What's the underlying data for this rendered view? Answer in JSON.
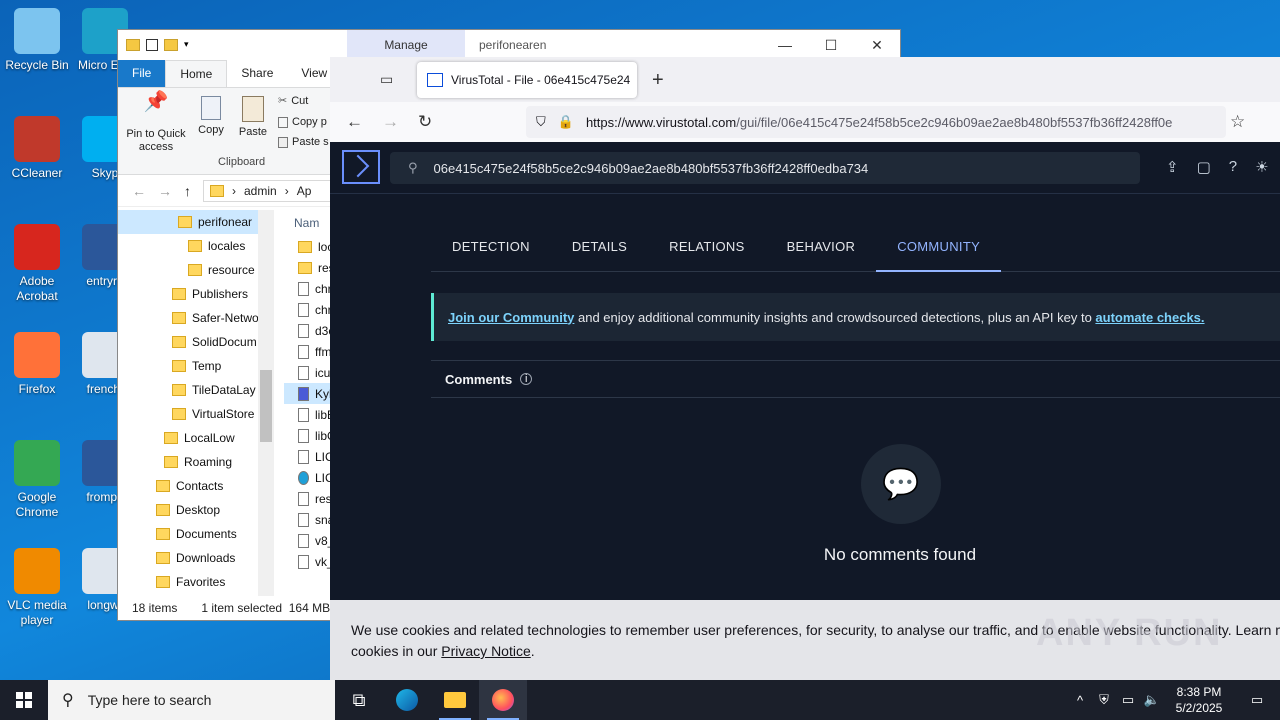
{
  "desktop": {
    "icons_left": [
      {
        "label": "Recycle Bin",
        "icon": "recycle-bin-icon",
        "color": "#7cc4ef"
      },
      {
        "label": "CCleaner",
        "icon": "ccleaner-icon",
        "color": "#c0392b"
      },
      {
        "label": "Adobe Acrobat",
        "icon": "adobe-acrobat-icon",
        "color": "#d7261e"
      },
      {
        "label": "Firefox",
        "icon": "firefox-icon",
        "color": "#ff7139"
      },
      {
        "label": "Google Chrome",
        "icon": "chrome-icon",
        "color": "#34a853"
      },
      {
        "label": "VLC media player",
        "icon": "vlc-icon",
        "color": "#f08a00"
      }
    ],
    "icons_right": [
      {
        "label": "Micro Edg",
        "icon": "edge-icon",
        "color": "#1da1c9"
      },
      {
        "label": "Skyp",
        "icon": "skype-icon",
        "color": "#00aff0"
      },
      {
        "label": "entryre",
        "icon": "word-doc-icon",
        "color": "#2b579a"
      },
      {
        "label": "frencht",
        "icon": "image-file-icon",
        "color": "#dfe6ee"
      },
      {
        "label": "frompa",
        "icon": "word-doc-icon",
        "color": "#2b579a"
      },
      {
        "label": "longwr",
        "icon": "image-file-icon",
        "color": "#dfe6ee"
      }
    ]
  },
  "explorer": {
    "manage_tab": "Manage",
    "title": "perifonearen",
    "window_controls": {
      "minimize": "—",
      "maximize": "☐",
      "close": "✕"
    },
    "ribbon_tabs": [
      "File",
      "Home",
      "Share",
      "View"
    ],
    "ribbon": {
      "pin_label": "Pin to Quick access",
      "copy_label": "Copy",
      "paste_label": "Paste",
      "cut_label": "Cut",
      "copy_path_label": "Copy p",
      "paste_shortcut_label": "Paste s",
      "group_label": "Clipboard"
    },
    "address": {
      "crumbs": [
        "admin",
        "Ap"
      ]
    },
    "nav_items": [
      {
        "label": "perifonear",
        "indent": 60,
        "selected": true
      },
      {
        "label": "locales",
        "indent": 70,
        "selected": false
      },
      {
        "label": "resource",
        "indent": 70,
        "selected": false
      },
      {
        "label": "Publishers",
        "indent": 54,
        "selected": false
      },
      {
        "label": "Safer-Netwo",
        "indent": 54,
        "selected": false
      },
      {
        "label": "SolidDocum",
        "indent": 54,
        "selected": false
      },
      {
        "label": "Temp",
        "indent": 54,
        "selected": false
      },
      {
        "label": "TileDataLay",
        "indent": 54,
        "selected": false
      },
      {
        "label": "VirtualStore",
        "indent": 54,
        "selected": false
      },
      {
        "label": "LocalLow",
        "indent": 46,
        "selected": false
      },
      {
        "label": "Roaming",
        "indent": 46,
        "selected": false
      },
      {
        "label": "Contacts",
        "indent": 38,
        "selected": false
      },
      {
        "label": "Desktop",
        "indent": 38,
        "selected": false
      },
      {
        "label": "Documents",
        "indent": 38,
        "selected": false
      },
      {
        "label": "Downloads",
        "indent": 38,
        "selected": false
      },
      {
        "label": "Favorites",
        "indent": 38,
        "selected": false
      }
    ],
    "column_header": "Nam",
    "files": [
      {
        "name": "loc",
        "type": "folder"
      },
      {
        "name": "res",
        "type": "folder"
      },
      {
        "name": "chr",
        "type": "doc"
      },
      {
        "name": "chr",
        "type": "doc"
      },
      {
        "name": "d3c",
        "type": "doc"
      },
      {
        "name": "ffm",
        "type": "doc"
      },
      {
        "name": "icu",
        "type": "doc"
      },
      {
        "name": "Kyl",
        "type": "exe",
        "selected": true
      },
      {
        "name": "libE",
        "type": "doc"
      },
      {
        "name": "libG",
        "type": "doc"
      },
      {
        "name": "LIC",
        "type": "doc"
      },
      {
        "name": "LIC",
        "type": "edge"
      },
      {
        "name": "res",
        "type": "doc"
      },
      {
        "name": "sna",
        "type": "doc"
      },
      {
        "name": "v8_",
        "type": "doc"
      },
      {
        "name": "vk_",
        "type": "doc"
      }
    ],
    "status": {
      "count": "18 items",
      "selected": "1 item selected",
      "size": "164 MB"
    }
  },
  "browser": {
    "tab_title": "VirusTotal - File - 06e415c475e24",
    "url_domain": "https://www.virustotal.com",
    "url_path": "/gui/file/06e415c475e24f58b5ce2c946b09ae2ae8b480bf5537fb36ff2428ff0e",
    "vt": {
      "search_value": "06e415c475e24f58b5ce2c946b09ae2ae8b480bf5537fb36ff2428ff0edba734",
      "tabs": [
        "DETECTION",
        "DETAILS",
        "RELATIONS",
        "BEHAVIOR",
        "COMMUNITY"
      ],
      "active_tab": "COMMUNITY",
      "banner_link": "Join our Community",
      "banner_text": " and enjoy additional community insights and crowdsourced detections, plus an API key to ",
      "banner_link2": "automate checks.",
      "comments_title": "Comments",
      "empty_text": "No comments found"
    },
    "cookie": {
      "line1": "We use cookies and related technologies to remember user preferences, for security, to analyse our traffic, and to enable website functionality. Learn more ab",
      "line2_prefix": "cookies in our ",
      "line2_link": "Privacy Notice",
      "line2_suffix": "."
    },
    "watermark": "ANY RUN"
  },
  "taskbar": {
    "search_placeholder": "Type here to search",
    "time": "8:38 PM",
    "date": "5/2/2025"
  }
}
